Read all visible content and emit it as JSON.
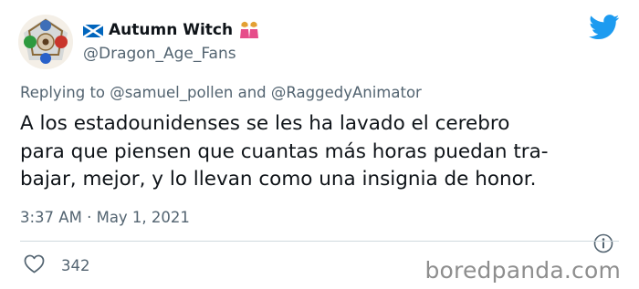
{
  "author": {
    "display_name": "Autumn Witch",
    "handle": "@Dragon_Age_Fans",
    "avatar_icon": "dragon-age-emblem-icon",
    "flag_icon": "scotland-flag-icon",
    "name_emoji_icon": "two-women-holding-hands-icon"
  },
  "platform_icon": "twitter-bird-icon",
  "reply": {
    "prefix": "Replying to",
    "mention_1": "@samuel_pollen",
    "joiner": "and",
    "mention_2": "@RaggedyAnimator"
  },
  "tweet": {
    "lines": [
      "A los estadounidenses se les ha lavado el cerebro",
      "para que piensen que cuantas más horas puedan tra-",
      "bajar, mejor, y lo llevan como una insignia de honor."
    ]
  },
  "meta": {
    "time": "3:37 AM",
    "separator": "·",
    "date": "May 1, 2021",
    "info_icon": "info-icon"
  },
  "engagement": {
    "like_icon": "heart-icon",
    "like_count": "342"
  },
  "watermark": "boredpanda.com",
  "colors": {
    "twitter_blue": "#1d9bf0",
    "secondary_text": "#536471",
    "primary_text": "#0f1419",
    "watermark": "#8e8e8e"
  }
}
